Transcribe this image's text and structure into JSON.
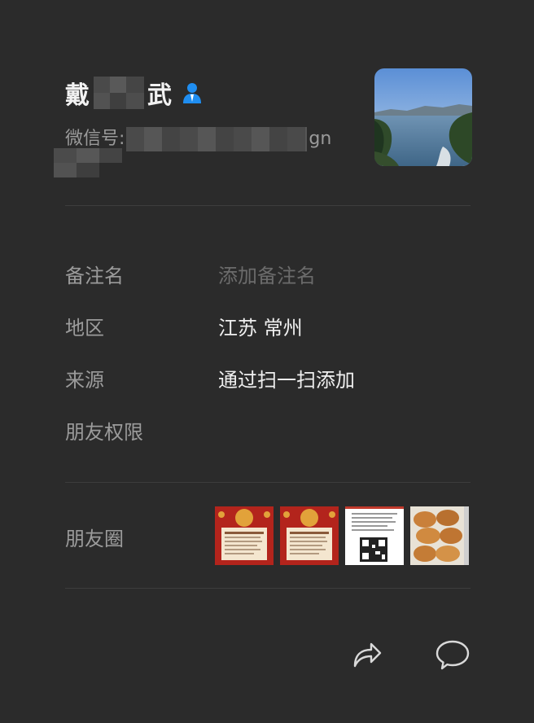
{
  "profile": {
    "name_first": "戴",
    "name_last": "武",
    "wechat_id_prefix": "微信号:",
    "wechat_id_suffix": "gn",
    "gender_icon": "male-person-icon",
    "accent_color": "#1f8ef1"
  },
  "info": {
    "remark_label": "备注名",
    "remark_placeholder": "添加备注名",
    "region_label": "地区",
    "region_value": "江苏 常州",
    "source_label": "来源",
    "source_value": "通过扫一扫添加",
    "permission_label": "朋友权限"
  },
  "moments": {
    "label": "朋友圈",
    "thumbs": [
      "red-festive-poster",
      "red-festive-poster",
      "qr-code-notice",
      "fried-buns-photo"
    ]
  },
  "actions": {
    "share_icon": "share-icon",
    "message_icon": "chat-bubble-icon"
  }
}
